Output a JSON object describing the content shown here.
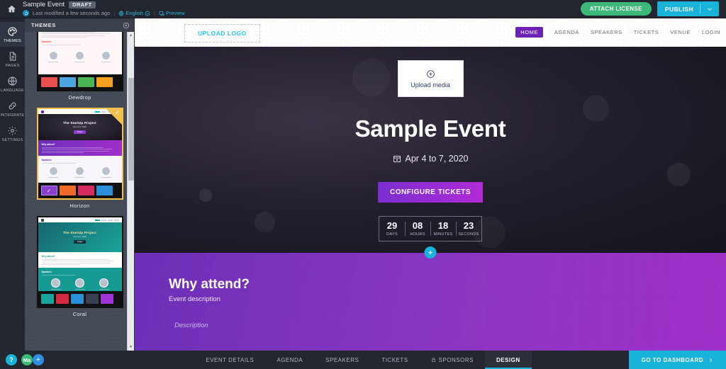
{
  "topbar": {
    "home_icon": "home-icon",
    "event_title": "Sample Event",
    "status_badge": "DRAFT",
    "modified_text": "Last modified a few seconds ago",
    "language": "English",
    "preview": "Preview",
    "separator": "|",
    "attach_license": "ATTACH LICENSE",
    "publish": "PUBLISH"
  },
  "rail": {
    "items": [
      {
        "label": "THEMES",
        "icon": "palette-icon",
        "active": true
      },
      {
        "label": "PAGES",
        "icon": "pages-icon",
        "active": false
      },
      {
        "label": "LANGUAGE",
        "icon": "globe-icon",
        "active": false
      },
      {
        "label": "INTEGRATE",
        "icon": "integrate-icon",
        "active": false
      },
      {
        "label": "SETTINGS",
        "icon": "gear-icon",
        "active": false
      }
    ]
  },
  "themes_panel": {
    "title": "THEMES",
    "close_icon": "close-icon",
    "themes": [
      {
        "name": "Dewdrop",
        "selected": false,
        "swatches": [
          "#e8504f",
          "#4ea6e0",
          "#49b356",
          "#f2a01e"
        ],
        "selected_swatch": -1,
        "thumb": {
          "hero_bg": "#cfe8f5",
          "accent": "#e8504f",
          "title": "",
          "body_bg": "#fff7f7"
        }
      },
      {
        "name": "Horizon",
        "selected": true,
        "swatches": [
          "#8b3fd1",
          "#f06a2a",
          "#d62b5e",
          "#2a8fd6"
        ],
        "selected_swatch": 0,
        "thumb": {
          "hero_bg": "#241f2e",
          "accent": "#8b3fd1",
          "title": "The StartUp Project",
          "body_bg": "#f7f4fb"
        }
      },
      {
        "name": "Coral",
        "selected": false,
        "swatches": [
          "#1aa39a",
          "#d62b43",
          "#2a8fd6",
          "#39404f",
          "#a034d6"
        ],
        "selected_swatch": -1,
        "thumb": {
          "hero_bg": "#13757a",
          "accent": "#1aa39a",
          "title": "The StartUp Project",
          "body_bg": "#ffffff"
        }
      }
    ]
  },
  "scrollbar": {
    "up_icon": "chevron-up-icon",
    "down_icon": "chevron-down-icon"
  },
  "preview": {
    "upload_logo": "UPLOAD LOGO",
    "nav": [
      {
        "label": "HOME",
        "active": true
      },
      {
        "label": "AGENDA",
        "active": false
      },
      {
        "label": "SPEAKERS",
        "active": false
      },
      {
        "label": "TICKETS",
        "active": false
      },
      {
        "label": "VENUE",
        "active": false
      },
      {
        "label": "LOGIN",
        "active": false
      }
    ],
    "upload_media": "Upload media",
    "hero_title": "Sample Event",
    "hero_date": "Apr 4 to 7, 2020",
    "configure_tickets": "CONFIGURE TICKETS",
    "countdown": [
      {
        "value": "29",
        "label": "DAYS"
      },
      {
        "value": "08",
        "label": "HOURS"
      },
      {
        "value": "18",
        "label": "MINUTES"
      },
      {
        "value": "23",
        "label": "SECONDS"
      }
    ],
    "add_section_icon": "plus-icon",
    "why_title": "Why attend?",
    "why_subtitle": "Event description",
    "why_description": "Description"
  },
  "bottombar": {
    "help": "?",
    "avatar": "Ma",
    "add": "+",
    "tabs": [
      {
        "label": "EVENT DETAILS",
        "active": false,
        "icon": ""
      },
      {
        "label": "AGENDA",
        "active": false,
        "icon": ""
      },
      {
        "label": "SPEAKERS",
        "active": false,
        "icon": ""
      },
      {
        "label": "TICKETS",
        "active": false,
        "icon": ""
      },
      {
        "label": "SPONSORS",
        "active": false,
        "icon": "lock-icon"
      },
      {
        "label": "DESIGN",
        "active": true,
        "icon": ""
      }
    ],
    "dashboard": "GO TO DASHBOARD"
  },
  "colors": {
    "accent_cyan": "#19b2d8",
    "accent_green": "#3cb878",
    "accent_purple": "#6b22b5",
    "chrome_dark": "#22262f",
    "panel_gray": "#444b57",
    "highlight_yellow": "#f2c14b"
  }
}
